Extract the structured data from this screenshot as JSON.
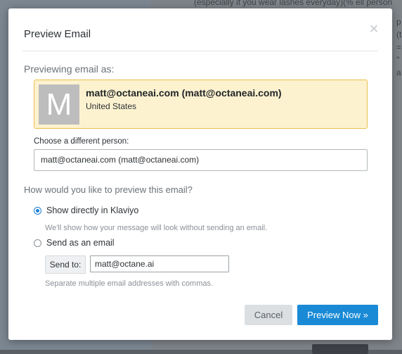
{
  "background": {
    "text_line": "(especially if you wear lashes everyday)(% ell person",
    "side_chars": [
      "p",
      "(th",
      "= \"",
      "a"
    ]
  },
  "modal": {
    "title": "Preview Email",
    "close_glyph": "×",
    "previewing_label": "Previewing email as:",
    "person": {
      "avatar_initial": "M",
      "name": "matt@octaneai.com (matt@octaneai.com)",
      "country": "United States"
    },
    "choose_label": "Choose a different person:",
    "choose_value": "matt@octaneai.com (matt@octaneai.com)",
    "how_label": "How would you like to preview this email?",
    "options": [
      {
        "label": "Show directly in Klaviyo",
        "checked": true,
        "help": "We'll show how your message will look without sending an email."
      },
      {
        "label": "Send as an email",
        "checked": false
      }
    ],
    "send_to": {
      "addon": "Send to:",
      "value": "matt@octane.ai",
      "help": "Separate multiple email addresses with commas."
    },
    "buttons": {
      "cancel": "Cancel",
      "preview": "Preview Now »"
    }
  },
  "colors": {
    "primary": "#1a8ad6",
    "card_bg": "#fdf2cf",
    "card_border": "#e9c04d"
  }
}
